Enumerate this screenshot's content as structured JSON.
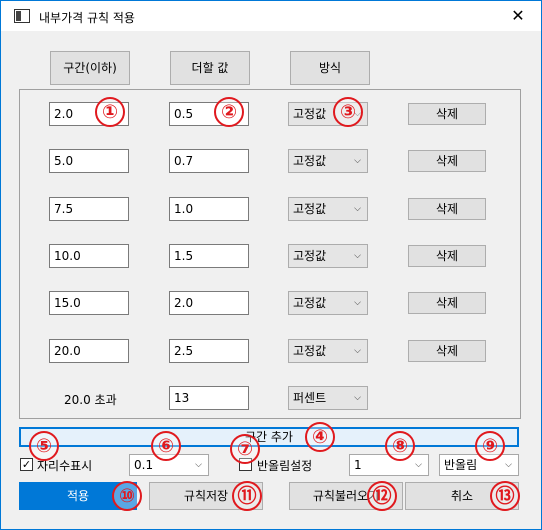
{
  "window": {
    "title": "내부가격 규칙 적용",
    "close_glyph": "✕"
  },
  "headers": {
    "range": "구간(이하)",
    "add_value": "더할 값",
    "method": "방식"
  },
  "rows": [
    {
      "range": "2.0",
      "add": "0.5",
      "method": "고정값",
      "delete": "삭제"
    },
    {
      "range": "5.0",
      "add": "0.7",
      "method": "고정값",
      "delete": "삭제"
    },
    {
      "range": "7.5",
      "add": "1.0",
      "method": "고정값",
      "delete": "삭제"
    },
    {
      "range": "10.0",
      "add": "1.5",
      "method": "고정값",
      "delete": "삭제"
    },
    {
      "range": "15.0",
      "add": "2.0",
      "method": "고정값",
      "delete": "삭제"
    },
    {
      "range": "20.0",
      "add": "2.5",
      "method": "고정값",
      "delete": "삭제"
    }
  ],
  "overflow_row": {
    "label": "20.0 초과",
    "add": "13",
    "method": "퍼센트"
  },
  "add_section_button": "구간 추가",
  "options": {
    "decimal_display_label": "자리수표시",
    "decimal_display_checked": true,
    "decimal_value": "0.1",
    "rounding_label": "반올림설정",
    "rounding_checked": false,
    "rounding_digits": "1",
    "rounding_mode": "반올림"
  },
  "buttons": {
    "apply": "적용",
    "save_rules": "규칙저장",
    "load_rules": "규칙불러오기",
    "cancel": "취소"
  },
  "callouts": [
    "①",
    "②",
    "③",
    "④",
    "⑤",
    "⑥",
    "⑦",
    "⑧",
    "⑨",
    "⑩",
    "⑪",
    "⑫",
    "⑬"
  ],
  "colors": {
    "accent": "#0078d7",
    "callout": "#e0191e"
  }
}
